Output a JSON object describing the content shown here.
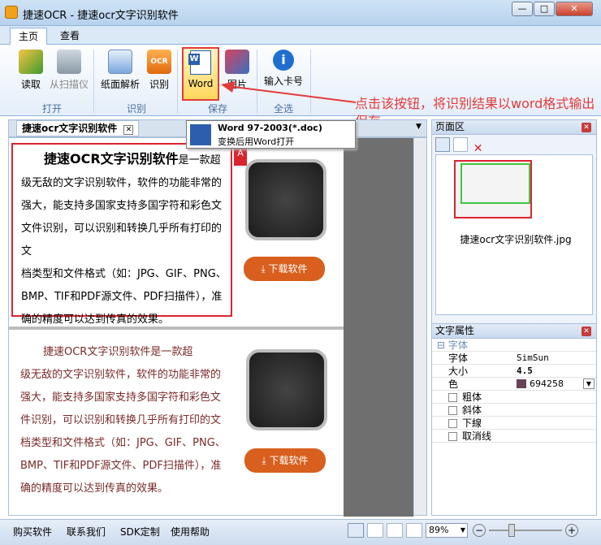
{
  "window": {
    "title": "捷速OCR - 捷速ocr文字识别软件",
    "min": "—",
    "max": "□",
    "close": "✕"
  },
  "ribbon_tabs": [
    {
      "label": "主页"
    },
    {
      "label": "查看"
    }
  ],
  "ribbon": {
    "buttons": {
      "read": "读取",
      "scanner": "从扫描仪",
      "layout": "纸面解析",
      "recognize": "识别",
      "word": "Word",
      "picture": "图片",
      "card": "输入卡号"
    },
    "groups": {
      "open": "打开",
      "recognize": "识别",
      "save": "保存",
      "select_all": "全选"
    }
  },
  "annotation": "点击该按钮，将识别结果以word格式输出保存",
  "tooltip": {
    "title": "Word 97-2003(*.doc)",
    "desc": "变换后用Word打开"
  },
  "doc_tab": {
    "label": "捷速ocr文字识别软件"
  },
  "panel1": {
    "title": "捷速OCR文字识别软件",
    "title_rest": "是一款超",
    "lines": [
      "级无敌的文字识别软件，软件的功能非常的",
      "强大，能支持多国家支持多国字符和彩色文",
      "文件识别，可以识别和转换几乎所有打印的文",
      "档类型和文件格式（如：JPG、GIF、PNG、",
      "BMP、TIF和PDF源文件、PDF扫描件），准",
      "确的精度可以达到传真的效果。"
    ],
    "download": "下载软件",
    "badge": "A"
  },
  "panel2": {
    "lines": [
      "捷速OCR文字识别软件是一款超",
      "级无敌的文字识别软件，软件的功能非常的",
      "强大，能支持多国家支持多国字符和彩色文",
      "件识别，可以识别和转换几乎所有打印的文",
      "档类型和文件格式（如：JPG、GIF、PNG、",
      "BMP、TIF和PDF源文件、PDF扫描件），准",
      "确的精度可以达到传真的效果。"
    ],
    "download": "下载软件"
  },
  "page_pane": {
    "title": "页面区",
    "thumb_label": "捷速ocr文字识别软件.jpg"
  },
  "props_pane": {
    "title": "文字属性",
    "group": "字体",
    "rows": [
      {
        "k": "字体",
        "v": "SimSun"
      },
      {
        "k": "大小",
        "v": "4.5"
      },
      {
        "k": "色",
        "v": "694258"
      }
    ],
    "checks": [
      "粗体",
      "斜体",
      "下線",
      "取消线"
    ],
    "color": "#694258"
  },
  "status": {
    "buy": "购买软件",
    "contact": "联系我们",
    "sdk": "SDK定制",
    "help": "使用帮助",
    "zoom": "89%"
  },
  "colors": {
    "accent": "#e23b3b",
    "orange": "#d85f1d"
  }
}
